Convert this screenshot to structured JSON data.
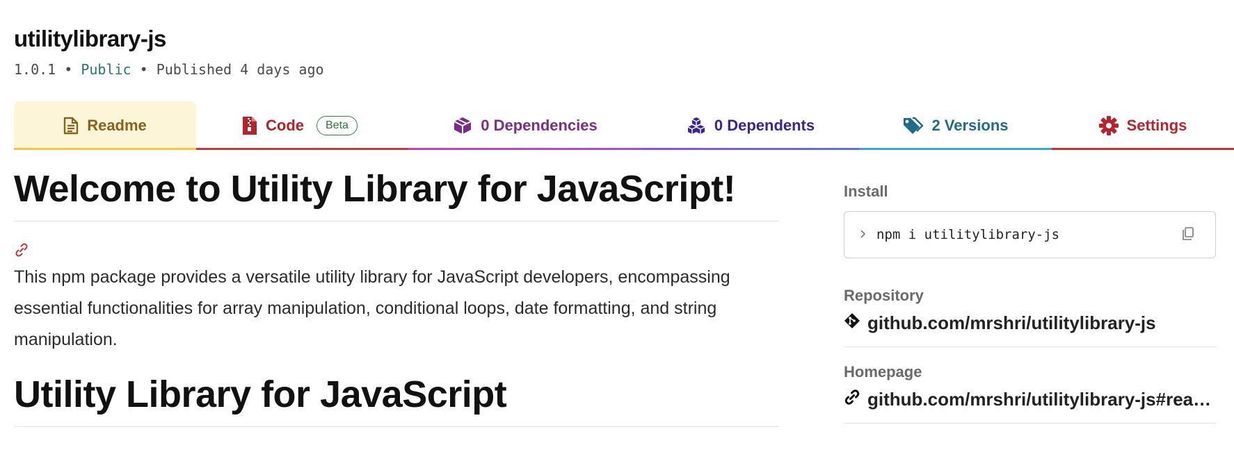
{
  "package": {
    "name": "utilitylibrary-js",
    "version": "1.0.1",
    "separator": " • ",
    "visibility": "Public",
    "published": "Published 4 days ago"
  },
  "tabs": {
    "readme": "Readme",
    "code": "Code",
    "code_badge": "Beta",
    "dependencies": "0 Dependencies",
    "dependents": "0 Dependents",
    "versions": "2 Versions",
    "settings": "Settings"
  },
  "icons": {
    "readme": "file-text-icon",
    "code": "file-zip-icon",
    "dependencies": "box-icon",
    "dependents": "boxes-icon",
    "versions": "tags-icon",
    "settings": "gear-icon",
    "anchor": "link-icon",
    "install_prompt": "chevron-right-icon",
    "copy": "copy-icon",
    "repository": "git-icon",
    "homepage": "link-icon"
  },
  "readme": {
    "heading1": "Welcome to Utility Library for JavaScript!",
    "paragraph": "This npm package provides a versatile utility library for JavaScript developers, encompassing essential functionalities for array manipulation, conditional loops, date formatting, and string manipulation.",
    "heading2": "Utility Library for JavaScript"
  },
  "sidebar": {
    "install_label": "Install",
    "install_command": "npm i utilitylibrary-js",
    "repository_label": "Repository",
    "repository_link": "github.com/mrshri/utilitylibrary-js",
    "homepage_label": "Homepage",
    "homepage_link": "github.com/mrshri/utilitylibrary-js#rea…"
  },
  "colors": {
    "readme_tab": "#86641e",
    "readme_tab_bg": "#fdf5d8",
    "code_tab": "#b5232a",
    "dependencies_tab": "#7b2c88",
    "dependents_tab": "#3b2397",
    "versions_tab": "#1e6b8a",
    "settings_tab": "#b8232b",
    "public": "#227a6c",
    "beta_badge": "#2a7a36"
  }
}
